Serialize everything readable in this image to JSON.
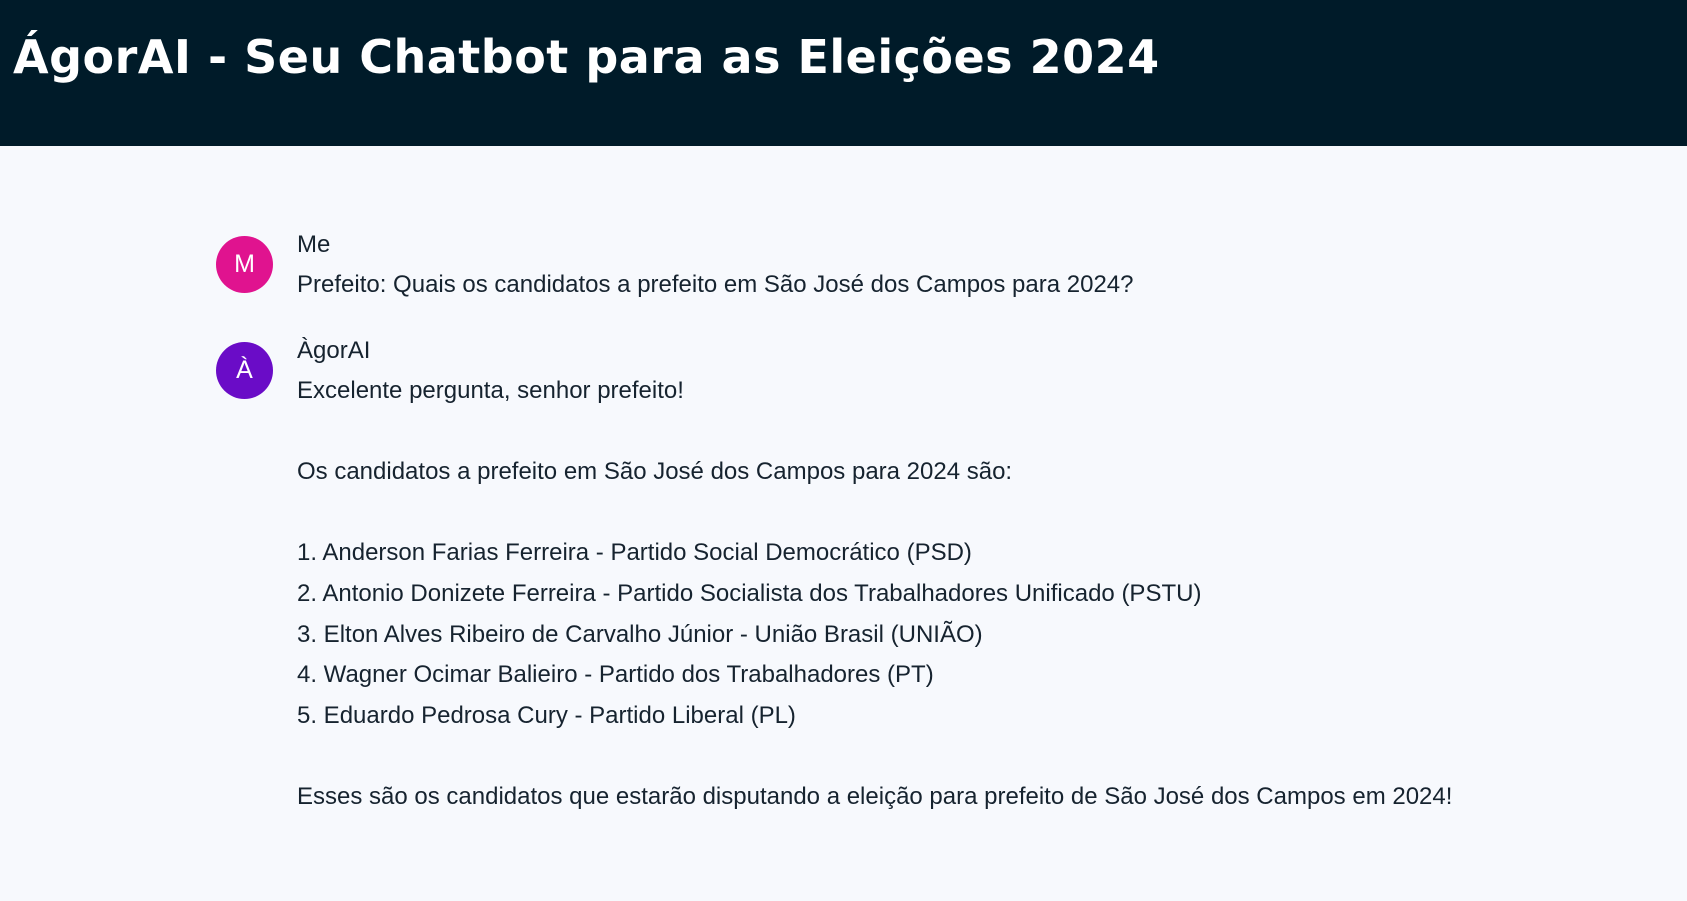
{
  "header": {
    "title": "ÁgorAI - Seu Chatbot para as Eleições 2024"
  },
  "messages": [
    {
      "author": "Me",
      "avatar_letter": "M",
      "avatar_color": "#e0138f",
      "lines": [
        "Prefeito: Quais os candidatos a prefeito em São José dos Campos para 2024?"
      ]
    },
    {
      "author": "ÀgorAI",
      "avatar_letter": "À",
      "avatar_color": "#6a0cc7",
      "lines": [
        "Excelente pergunta, senhor prefeito!",
        "",
        "Os candidatos a prefeito em São José dos Campos para 2024 são:",
        "",
        "1. Anderson Farias Ferreira - Partido Social Democrático (PSD)",
        "2. Antonio Donizete Ferreira - Partido Socialista dos Trabalhadores Unificado (PSTU)",
        "3. Elton Alves Ribeiro de Carvalho Júnior - União Brasil (UNIÃO)",
        "4. Wagner Ocimar Balieiro - Partido dos Trabalhadores (PT)",
        "5. Eduardo Pedrosa Cury - Partido Liberal (PL)",
        "",
        "Esses são os candidatos que estarão disputando a eleição para prefeito de São José dos Campos em 2024!"
      ]
    }
  ],
  "colors": {
    "header_bg": "#001b29",
    "page_bg": "#f7f9fd",
    "text": "#16232f"
  }
}
